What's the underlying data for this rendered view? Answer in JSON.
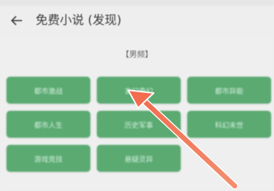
{
  "header": {
    "title": "免费小说 (发现)",
    "back_icon": "arrow-left-icon"
  },
  "section": {
    "label": "【男频】"
  },
  "categories": [
    {
      "label": "都市激战"
    },
    {
      "label": "玄幻奇幻"
    },
    {
      "label": "都市异能"
    },
    {
      "label": "都市人生"
    },
    {
      "label": "历史军事"
    },
    {
      "label": "科幻末世"
    },
    {
      "label": "游戏竞技"
    },
    {
      "label": "悬疑灵异"
    }
  ],
  "annotation": {
    "arrow_color": "#f07a5a",
    "arrow_target": "categories.1"
  },
  "colors": {
    "button_green": "#5aaa72",
    "background": "#efefef"
  }
}
